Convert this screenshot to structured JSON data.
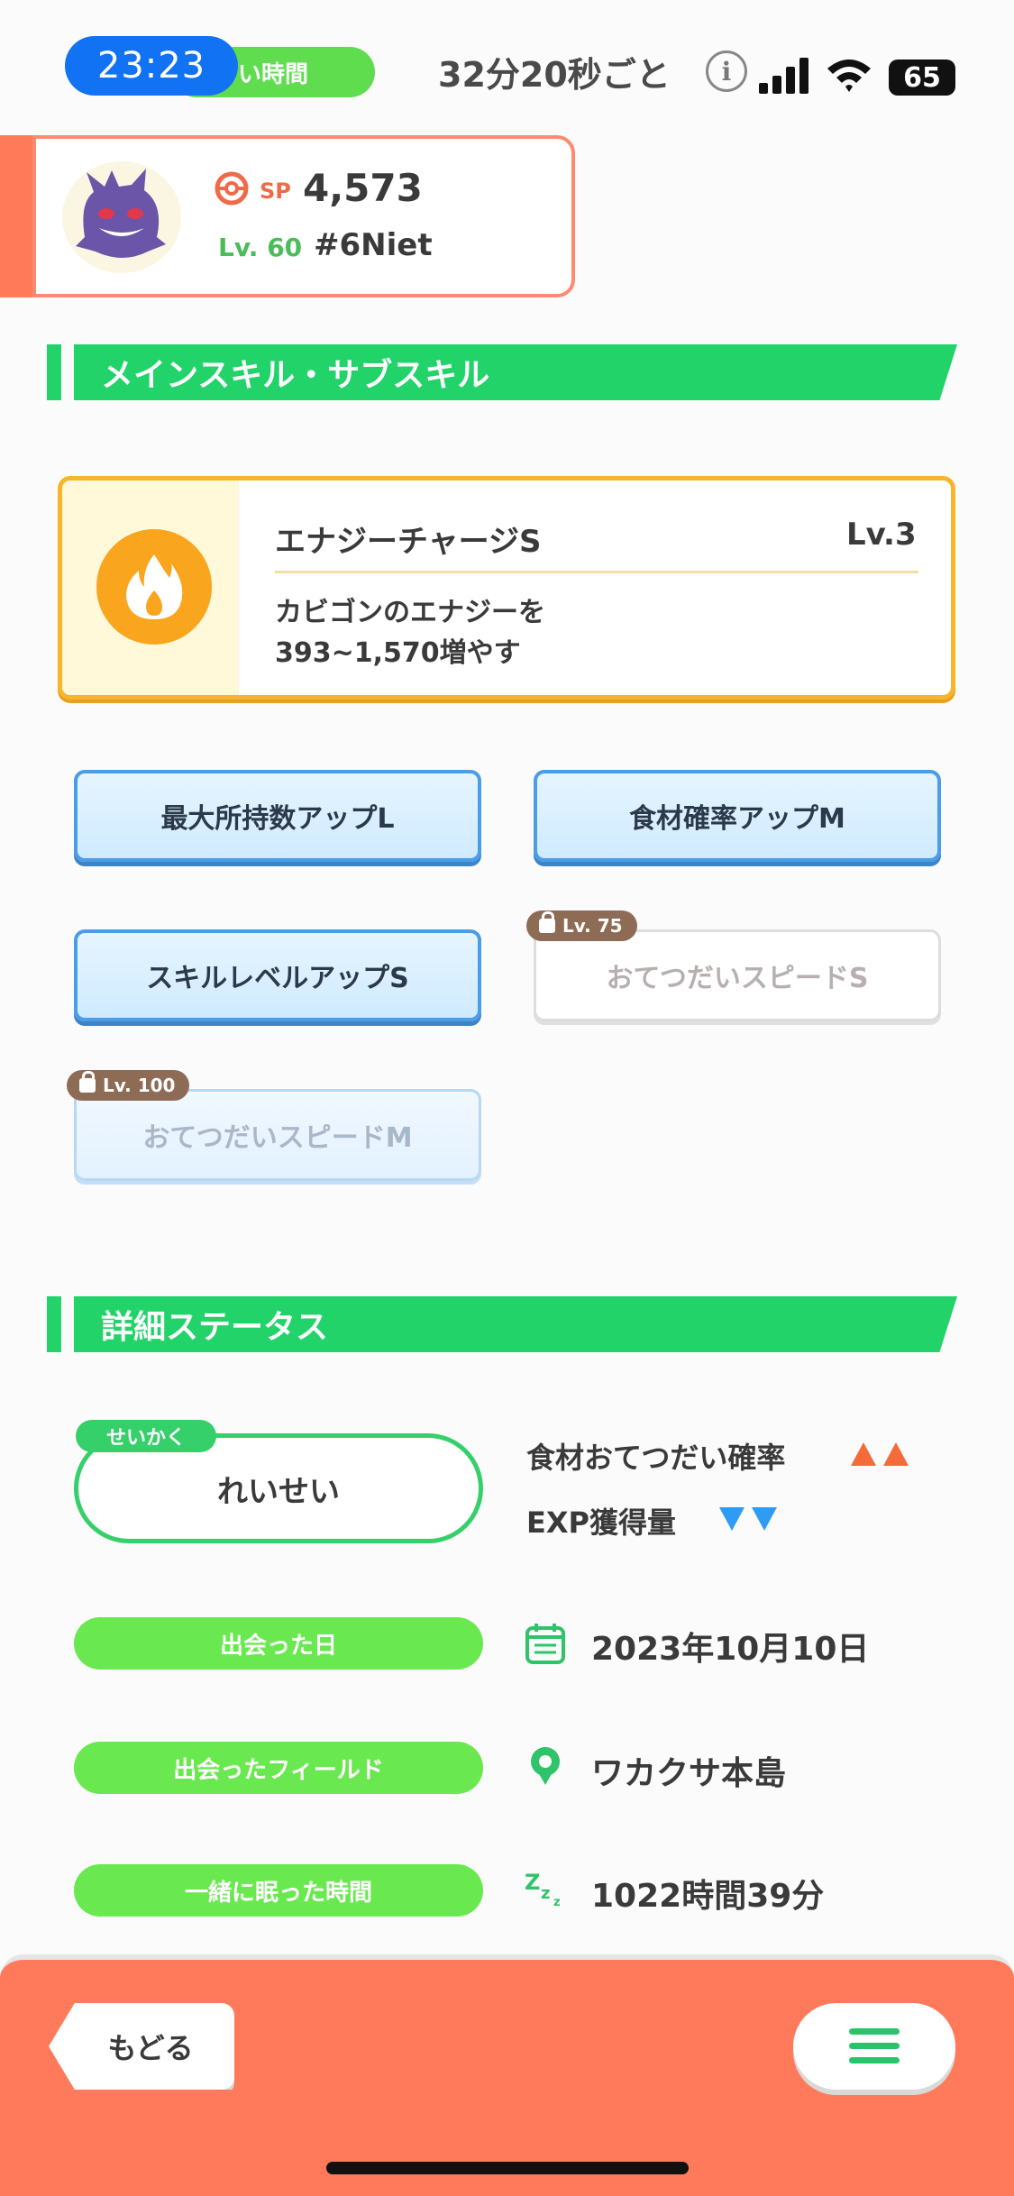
{
  "status_bar": {
    "time": "23:23",
    "pill_label": "い時間",
    "interval_text": "32分20秒ごと",
    "battery": "65"
  },
  "profile": {
    "sp_label": "SP",
    "sp_value": "4,573",
    "level": "Lv. 60",
    "name": "#6Niet",
    "avatar_icon": "gengar-avatar"
  },
  "skills_section": {
    "title": "メインスキル・サブスキル",
    "main_skill": {
      "name": "エナジーチャージS",
      "level": "Lv.3",
      "description_line1": "カビゴンのエナジーを",
      "description_line2": "393~1,570増やす",
      "icon": "flame-icon"
    },
    "sub_skills": [
      {
        "label": "最大所持数アップL"
      },
      {
        "label": "食材確率アップM"
      },
      {
        "label": "スキルレベルアップS"
      },
      {
        "label": "おてつだいスピードS",
        "lock": "Lv. 75"
      },
      {
        "label": "おてつだいスピードM",
        "lock": "Lv. 100"
      }
    ]
  },
  "details_section": {
    "title": "詳細ステータス",
    "nature_tag": "せいかく",
    "nature": "れいせい",
    "nature_up": "食材おてつだい確率",
    "nature_down": "EXP獲得量",
    "rows": [
      {
        "label": "出会った日",
        "value": "2023年10月10日",
        "icon": "calendar-icon"
      },
      {
        "label": "出会ったフィールド",
        "value": "ワカクサ本島",
        "icon": "location-pin-icon"
      },
      {
        "label": "一緒に眠った時間",
        "value": "1022時間39分",
        "icon": "sleep-zzz-icon"
      }
    ]
  },
  "bottom_bar": {
    "back_label": "もどる",
    "menu_icon": "hamburger-icon"
  },
  "colors": {
    "accent_green": "#22d36a",
    "accent_orange": "#ff7a5a",
    "main_skill_border": "#f6b52a",
    "nature_up": "#f56a3a",
    "nature_down": "#2f9cf2"
  }
}
